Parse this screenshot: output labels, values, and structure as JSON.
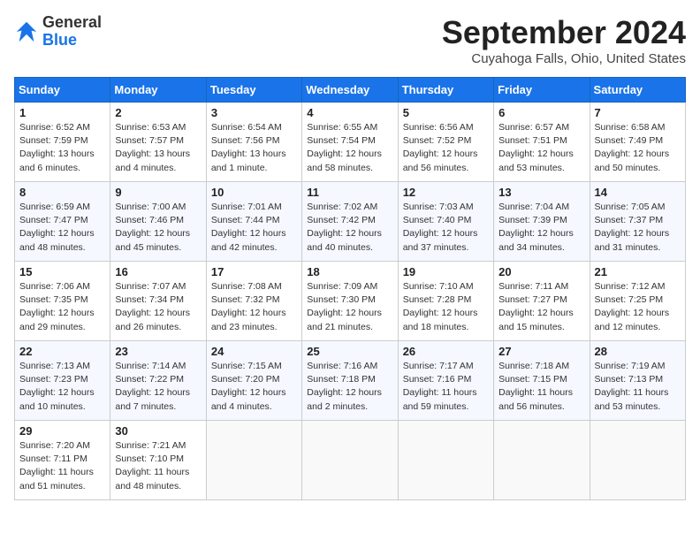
{
  "logo": {
    "general": "General",
    "blue": "Blue"
  },
  "header": {
    "month": "September 2024",
    "location": "Cuyahoga Falls, Ohio, United States"
  },
  "weekdays": [
    "Sunday",
    "Monday",
    "Tuesday",
    "Wednesday",
    "Thursday",
    "Friday",
    "Saturday"
  ],
  "weeks": [
    [
      {
        "day": "1",
        "info": "Sunrise: 6:52 AM\nSunset: 7:59 PM\nDaylight: 13 hours and 6 minutes."
      },
      {
        "day": "2",
        "info": "Sunrise: 6:53 AM\nSunset: 7:57 PM\nDaylight: 13 hours and 4 minutes."
      },
      {
        "day": "3",
        "info": "Sunrise: 6:54 AM\nSunset: 7:56 PM\nDaylight: 13 hours and 1 minute."
      },
      {
        "day": "4",
        "info": "Sunrise: 6:55 AM\nSunset: 7:54 PM\nDaylight: 12 hours and 58 minutes."
      },
      {
        "day": "5",
        "info": "Sunrise: 6:56 AM\nSunset: 7:52 PM\nDaylight: 12 hours and 56 minutes."
      },
      {
        "day": "6",
        "info": "Sunrise: 6:57 AM\nSunset: 7:51 PM\nDaylight: 12 hours and 53 minutes."
      },
      {
        "day": "7",
        "info": "Sunrise: 6:58 AM\nSunset: 7:49 PM\nDaylight: 12 hours and 50 minutes."
      }
    ],
    [
      {
        "day": "8",
        "info": "Sunrise: 6:59 AM\nSunset: 7:47 PM\nDaylight: 12 hours and 48 minutes."
      },
      {
        "day": "9",
        "info": "Sunrise: 7:00 AM\nSunset: 7:46 PM\nDaylight: 12 hours and 45 minutes."
      },
      {
        "day": "10",
        "info": "Sunrise: 7:01 AM\nSunset: 7:44 PM\nDaylight: 12 hours and 42 minutes."
      },
      {
        "day": "11",
        "info": "Sunrise: 7:02 AM\nSunset: 7:42 PM\nDaylight: 12 hours and 40 minutes."
      },
      {
        "day": "12",
        "info": "Sunrise: 7:03 AM\nSunset: 7:40 PM\nDaylight: 12 hours and 37 minutes."
      },
      {
        "day": "13",
        "info": "Sunrise: 7:04 AM\nSunset: 7:39 PM\nDaylight: 12 hours and 34 minutes."
      },
      {
        "day": "14",
        "info": "Sunrise: 7:05 AM\nSunset: 7:37 PM\nDaylight: 12 hours and 31 minutes."
      }
    ],
    [
      {
        "day": "15",
        "info": "Sunrise: 7:06 AM\nSunset: 7:35 PM\nDaylight: 12 hours and 29 minutes."
      },
      {
        "day": "16",
        "info": "Sunrise: 7:07 AM\nSunset: 7:34 PM\nDaylight: 12 hours and 26 minutes."
      },
      {
        "day": "17",
        "info": "Sunrise: 7:08 AM\nSunset: 7:32 PM\nDaylight: 12 hours and 23 minutes."
      },
      {
        "day": "18",
        "info": "Sunrise: 7:09 AM\nSunset: 7:30 PM\nDaylight: 12 hours and 21 minutes."
      },
      {
        "day": "19",
        "info": "Sunrise: 7:10 AM\nSunset: 7:28 PM\nDaylight: 12 hours and 18 minutes."
      },
      {
        "day": "20",
        "info": "Sunrise: 7:11 AM\nSunset: 7:27 PM\nDaylight: 12 hours and 15 minutes."
      },
      {
        "day": "21",
        "info": "Sunrise: 7:12 AM\nSunset: 7:25 PM\nDaylight: 12 hours and 12 minutes."
      }
    ],
    [
      {
        "day": "22",
        "info": "Sunrise: 7:13 AM\nSunset: 7:23 PM\nDaylight: 12 hours and 10 minutes."
      },
      {
        "day": "23",
        "info": "Sunrise: 7:14 AM\nSunset: 7:22 PM\nDaylight: 12 hours and 7 minutes."
      },
      {
        "day": "24",
        "info": "Sunrise: 7:15 AM\nSunset: 7:20 PM\nDaylight: 12 hours and 4 minutes."
      },
      {
        "day": "25",
        "info": "Sunrise: 7:16 AM\nSunset: 7:18 PM\nDaylight: 12 hours and 2 minutes."
      },
      {
        "day": "26",
        "info": "Sunrise: 7:17 AM\nSunset: 7:16 PM\nDaylight: 11 hours and 59 minutes."
      },
      {
        "day": "27",
        "info": "Sunrise: 7:18 AM\nSunset: 7:15 PM\nDaylight: 11 hours and 56 minutes."
      },
      {
        "day": "28",
        "info": "Sunrise: 7:19 AM\nSunset: 7:13 PM\nDaylight: 11 hours and 53 minutes."
      }
    ],
    [
      {
        "day": "29",
        "info": "Sunrise: 7:20 AM\nSunset: 7:11 PM\nDaylight: 11 hours and 51 minutes."
      },
      {
        "day": "30",
        "info": "Sunrise: 7:21 AM\nSunset: 7:10 PM\nDaylight: 11 hours and 48 minutes."
      },
      null,
      null,
      null,
      null,
      null
    ]
  ]
}
